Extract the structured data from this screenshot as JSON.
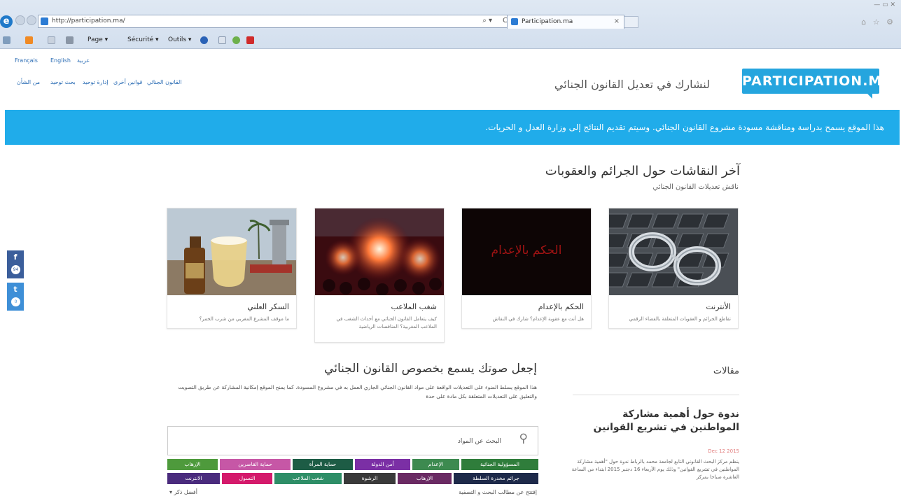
{
  "browser": {
    "url": "http://participation.ma/",
    "tab_title": "Participation.ma",
    "tab_close": "×",
    "window_controls": "— ▭ ✕",
    "corner_icons": "⌂ ☆ ⚙",
    "search_glyph": "⌕ ▾",
    "refresh_glyph": "C",
    "ie_logo": "e",
    "commands": [
      "Page ▾",
      "Sécurité ▾",
      "Outils ▾"
    ]
  },
  "header": {
    "languages": [
      "Français",
      "English",
      "عربية"
    ],
    "nav_links": [
      "القانون الجنائي",
      "قوانين أخرى",
      "إدارة توحيد",
      "بحث توحيد",
      "من الشأن"
    ],
    "tagline": "لنشارك في تعديل القانون الجنائي",
    "logo": "PARTICIPATION.MA"
  },
  "banner": {
    "text": "هذا الموقع يسمح بدراسة ومناقشة مسودة مشروع القانون الجنائي. وسيتم تقديم النتائج إلى وزارة العدل و الحريات."
  },
  "social": {
    "facebook": {
      "icon": "f",
      "count": "94"
    },
    "twitter": {
      "icon": "t",
      "count": "0"
    }
  },
  "discussions": {
    "title": "آخر النقاشات حول الجرائم والعقوبات",
    "subtitle": "ناقش تعديلات القانون الجنائي",
    "cards": [
      {
        "title": "الأنترنت",
        "desc": "تقاطع الجرائم و العقوبات المتعلقة بالفضاء الرقمي"
      },
      {
        "title": "الحكم بالإعدام",
        "desc": "هل أنت مع عقوبة الإعدام؟ شارك في النقاش",
        "image_text": "الحكم بالإعدام"
      },
      {
        "title": "شغب الملاعب",
        "desc": "كيف يتعامل القانون الجنائي مع أحداث الشغب في الملاعب المغربية؟ المنافسات الرياضية"
      },
      {
        "title": "السكر العلني",
        "desc": "ما موقف المشرع المغربي من شرب الخمر؟"
      }
    ]
  },
  "voice": {
    "title": "إجعل صوتك يسمع بخصوص القانون الجنائي",
    "text": "هذا الموقع يسلط الضوء على التعديلات الواقعة على مواد القانون الجنائي الجاري العمل به في مشروع المسودة. كما يمنح الموقع إمكانية المشاركة عن طريق التصويت والتعليق على التعديلات المتعلقة بكل مادة على حدة"
  },
  "search": {
    "placeholder": "البحث عن المواد"
  },
  "tags": {
    "row1": [
      {
        "label": "المسؤولية الجنائية",
        "color": "#2f7d3b"
      },
      {
        "label": "الإعدام",
        "color": "#3d8a50"
      },
      {
        "label": "أمن الدولة",
        "color": "#7b2fa5"
      },
      {
        "label": "حماية المرأة",
        "color": "#1d5c45"
      },
      {
        "label": "حماية القاصرين",
        "color": "#c657a6"
      },
      {
        "label": "الإرهاب",
        "color": "#4e9a3c"
      }
    ],
    "row2": [
      {
        "label": "جرائم مخدرة السلطة",
        "color": "#1e2a4a"
      },
      {
        "label": "الإرهاب",
        "color": "#6a2a63"
      },
      {
        "label": "الرشوة",
        "color": "#3a3a3a"
      },
      {
        "label": "شغب الملاعب",
        "color": "#2e8e67"
      },
      {
        "label": "التسول",
        "color": "#d41a6b"
      },
      {
        "label": "الانترنت",
        "color": "#4a2b7d"
      },
      {
        "label": "",
        "color": "#5a2f8a"
      }
    ]
  },
  "bottom": {
    "filter": "إفتتح عن مطالب البحث و التصفية",
    "more": "أفضل ذكر ▾"
  },
  "articles": {
    "title": "مقالات",
    "headline": "ندوة حول أهمية مشاركة المواطنين في تشريع القوانين",
    "date": "Dec 12 2015",
    "body": "ينظم مركز البحث القانوني التابع لجامعة محمد بالرباط ندوة حول \"أهمية مشاركة المواطنين في تشريع القوانين\" وذلك يوم الأربعاء 16 دجنبر 2015 ابتداء من الساعة العاشرة صباحا بمركز"
  }
}
